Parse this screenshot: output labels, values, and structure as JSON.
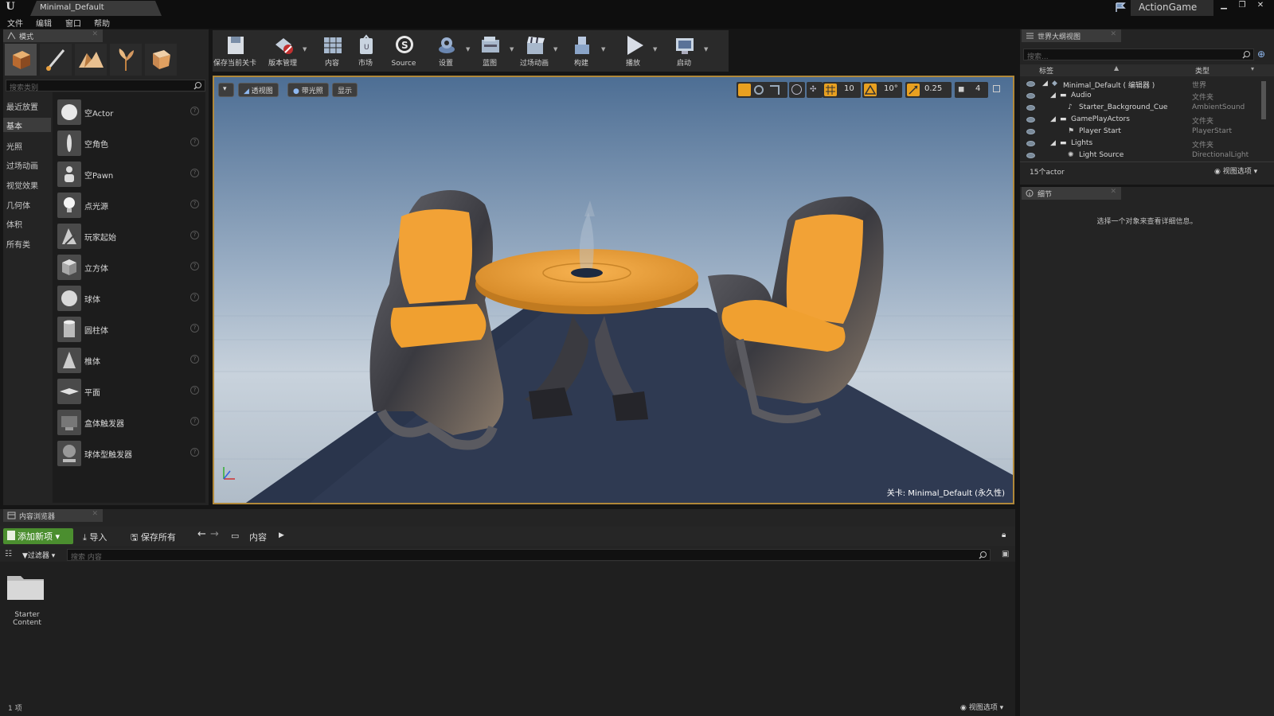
{
  "titlebar": {
    "tab_title": "Minimal_Default",
    "project": "ActionGame",
    "window_buttons": [
      "minimize",
      "maximize",
      "close"
    ]
  },
  "menubar": {
    "items": [
      "文件",
      "编辑",
      "窗口",
      "帮助"
    ]
  },
  "modes_panel": {
    "tab_label": "模式",
    "mode_icons": [
      "place-mode-icon",
      "paint-mode-icon",
      "landscape-mode-icon",
      "foliage-mode-icon",
      "geometry-mode-icon"
    ],
    "search_placeholder": "搜索类别",
    "categories": [
      "最近放置",
      "基本",
      "光照",
      "过场动画",
      "视觉效果",
      "几何体",
      "体积",
      "所有类"
    ],
    "active_category": "基本",
    "placeables": [
      {
        "label": "空Actor",
        "icon": "sphere-icon"
      },
      {
        "label": "空角色",
        "icon": "character-icon"
      },
      {
        "label": "空Pawn",
        "icon": "pawn-icon"
      },
      {
        "label": "点光源",
        "icon": "point-light-icon"
      },
      {
        "label": "玩家起始",
        "icon": "player-start-icon"
      },
      {
        "label": "立方体",
        "icon": "cube-icon"
      },
      {
        "label": "球体",
        "icon": "sphere-icon"
      },
      {
        "label": "圆柱体",
        "icon": "cylinder-icon"
      },
      {
        "label": "椎体",
        "icon": "cone-icon"
      },
      {
        "label": "平面",
        "icon": "plane-icon"
      },
      {
        "label": "盒体触发器",
        "icon": "box-trigger-icon"
      },
      {
        "label": "球体型触发器",
        "icon": "sphere-trigger-icon"
      }
    ]
  },
  "toolbar": {
    "buttons": [
      {
        "label": "保存当前关卡",
        "icon": "save-icon",
        "dropdown": false
      },
      {
        "label": "版本管理",
        "icon": "source-control-icon",
        "dropdown": true
      },
      {
        "label": "内容",
        "icon": "content-icon",
        "dropdown": false
      },
      {
        "label": "市场",
        "icon": "marketplace-icon",
        "dropdown": false
      },
      {
        "label": "Source",
        "icon": "source-icon",
        "dropdown": false
      },
      {
        "label": "设置",
        "icon": "settings-icon",
        "dropdown": true
      },
      {
        "label": "蓝图",
        "icon": "blueprint-icon",
        "dropdown": true
      },
      {
        "label": "过场动画",
        "icon": "cinematics-icon",
        "dropdown": true
      },
      {
        "label": "构建",
        "icon": "build-icon",
        "dropdown": true
      },
      {
        "label": "播放",
        "icon": "play-icon",
        "dropdown": true
      },
      {
        "label": "启动",
        "icon": "launch-icon",
        "dropdown": true
      }
    ]
  },
  "viewport": {
    "perspective_label": "透视图",
    "lit_label": "带光照",
    "show_label": "显示",
    "grid_snap": "10",
    "rotation_snap": "10°",
    "scale_snap": "0.25",
    "camera_speed": "4",
    "level_prefix": "关卡:",
    "level_name": "Minimal_Default (永久性)"
  },
  "outliner": {
    "tab_label": "世界大纲视图",
    "search_placeholder": "搜索...",
    "col_label": "标签",
    "col_type": "类型",
    "rows": [
      {
        "name": "Minimal_Default ( 编辑器 )",
        "type": "世界",
        "depth": 0,
        "icon": "world-icon"
      },
      {
        "name": "Audio",
        "type": "文件夹",
        "depth": 1,
        "icon": "folder-icon"
      },
      {
        "name": "Starter_Background_Cue",
        "type": "AmbientSound",
        "depth": 2,
        "icon": "sound-icon"
      },
      {
        "name": "GamePlayActors",
        "type": "文件夹",
        "depth": 1,
        "icon": "folder-icon"
      },
      {
        "name": "Player Start",
        "type": "PlayerStart",
        "depth": 2,
        "icon": "player-start-icon"
      },
      {
        "name": "Lights",
        "type": "文件夹",
        "depth": 1,
        "icon": "folder-icon"
      },
      {
        "name": "Light Source",
        "type": "DirectionalLight",
        "depth": 2,
        "icon": "directional-light-icon"
      }
    ],
    "actor_count": "15个actor",
    "view_options": "视图选项"
  },
  "details": {
    "tab_label": "细节",
    "empty_message": "选择一个对象来查看详细信息。"
  },
  "content_browser": {
    "tab_label": "内容浏览器",
    "add_new": "添加新项",
    "import": "导入",
    "save_all": "保存所有",
    "path_root": "内容",
    "filters": "过滤器",
    "search_placeholder": "搜索 内容",
    "folders": [
      {
        "name": "Starter Content"
      }
    ],
    "item_count": "1 项",
    "view_options": "视图选项"
  },
  "colors": {
    "viewport_border": "#b0883a",
    "add_new_green": "#4b8e2f",
    "panel_bg": "#242424",
    "chair_orange": "#f2a236",
    "selected_snap": "#e8a020"
  }
}
